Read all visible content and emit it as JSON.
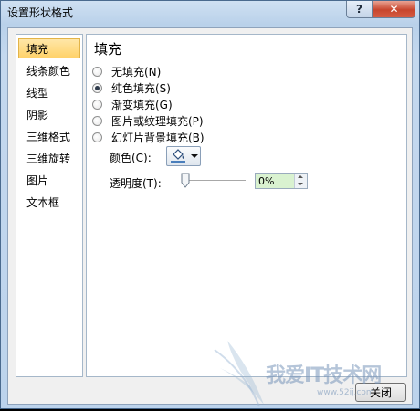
{
  "window": {
    "title": "设置形状格式",
    "help_label": "?",
    "close_glyph": "✕"
  },
  "nav": {
    "items": [
      {
        "label": "填充",
        "selected": true
      },
      {
        "label": "线条颜色"
      },
      {
        "label": "线型"
      },
      {
        "label": "阴影"
      },
      {
        "label": "三维格式"
      },
      {
        "label": "三维旋转"
      },
      {
        "label": "图片"
      },
      {
        "label": "文本框"
      }
    ]
  },
  "panel": {
    "heading": "填充",
    "fill_options": [
      {
        "label": "无填充(N)",
        "checked": false
      },
      {
        "label": "纯色填充(S)",
        "checked": true
      },
      {
        "label": "渐变填充(G)",
        "checked": false
      },
      {
        "label": "图片或纹理填充(P)",
        "checked": false
      },
      {
        "label": "幻灯片背景填充(B)",
        "checked": false
      }
    ],
    "color_label": "颜色(C):",
    "transparency_label": "透明度(T):",
    "transparency_value": "0%",
    "transparency_fraction": 0
  },
  "footer": {
    "close_label": "关闭"
  },
  "watermark": {
    "text": "我爱IT技术网",
    "url": "www.52ij.com"
  },
  "colors": {
    "selected_nav": "#ffd26a",
    "spin_field_bg": "#d9f2d0",
    "title_close": "#c7452d"
  }
}
